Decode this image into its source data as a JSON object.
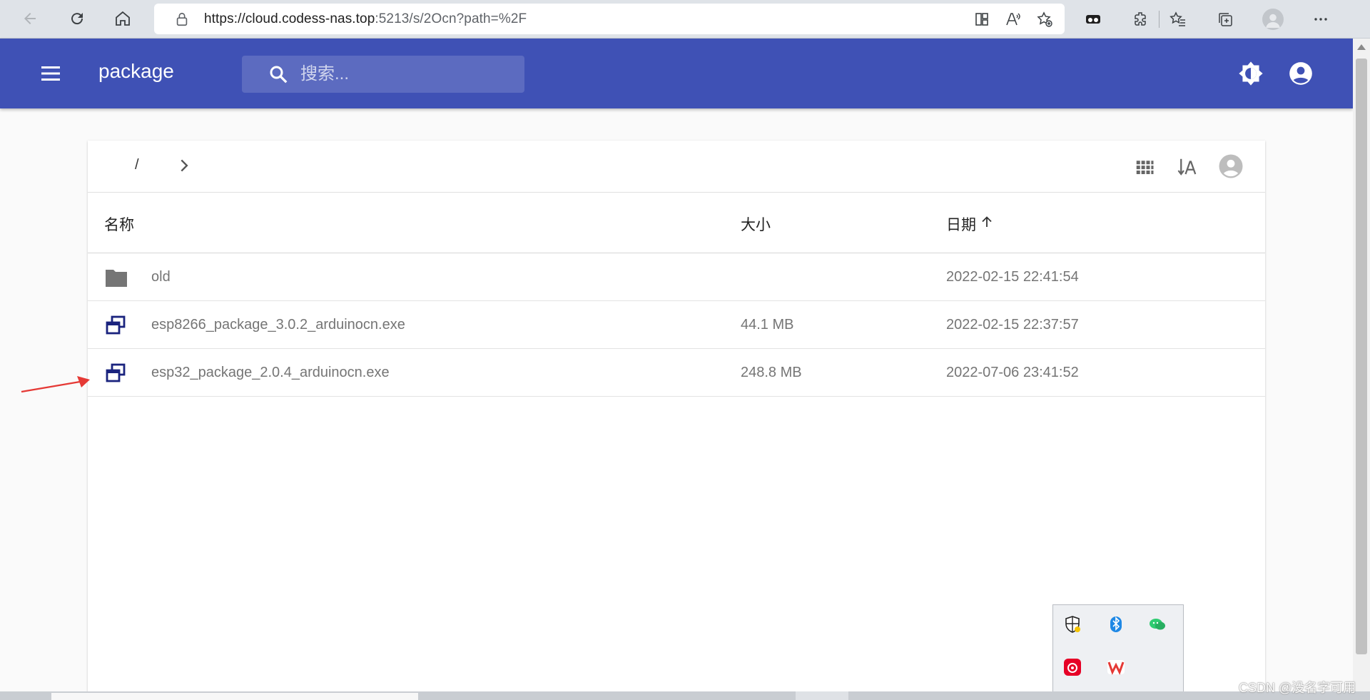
{
  "browser": {
    "url_host": "https://cloud.codess-nas.top",
    "url_rest": ":5213/s/2Ocn?path=%2F"
  },
  "header": {
    "title": "package",
    "search_placeholder": "搜索...",
    "color": "#3f51b5"
  },
  "toolbar": {
    "breadcrumb_root": "/"
  },
  "table": {
    "columns": {
      "name": "名称",
      "size": "大小",
      "date": "日期"
    },
    "rows": [
      {
        "name": "old",
        "size": "",
        "date": "2022-02-15 22:41:54",
        "icon": "folder-icon"
      },
      {
        "name": "esp8266_package_3.0.2_arduinocn.exe",
        "size": "44.1 MB",
        "date": "2022-02-15 22:37:57",
        "icon": "exe-file-icon"
      },
      {
        "name": "esp32_package_2.0.4_arduinocn.exe",
        "size": "248.8 MB",
        "date": "2022-07-06 23:41:52",
        "icon": "exe-file-icon"
      }
    ]
  },
  "watermark": "CSDN @没名字可用"
}
